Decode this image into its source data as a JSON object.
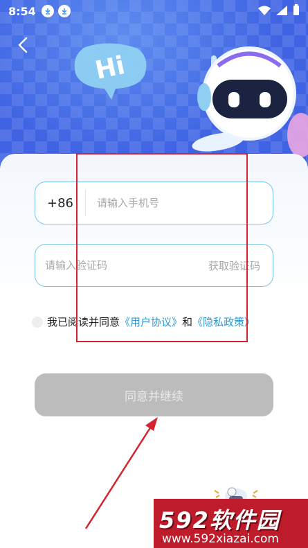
{
  "status_bar": {
    "time": "8:54"
  },
  "hero": {
    "bubble_text": "Hi"
  },
  "login": {
    "country_code": "+86",
    "phone_placeholder": "请输入手机号",
    "code_placeholder": "请输入验证码",
    "get_code_label": "获取验证码",
    "agree_prefix": "我已阅读并同意",
    "user_agreement_link": "《用户协议》",
    "agree_and": "和",
    "privacy_link": "《隐私政策》",
    "submit_label": "同意并继续"
  },
  "watermark": {
    "brand": "592软件园",
    "site": "www.592xiazai.com"
  },
  "colors": {
    "hero_blue": "#3f63e3",
    "field_border": "#7cc4e6",
    "link_blue": "#2f9bd6",
    "disabled_button": "#bcbcbc",
    "annotation_red": "#d4242f",
    "watermark_red": "#be1c2a"
  }
}
